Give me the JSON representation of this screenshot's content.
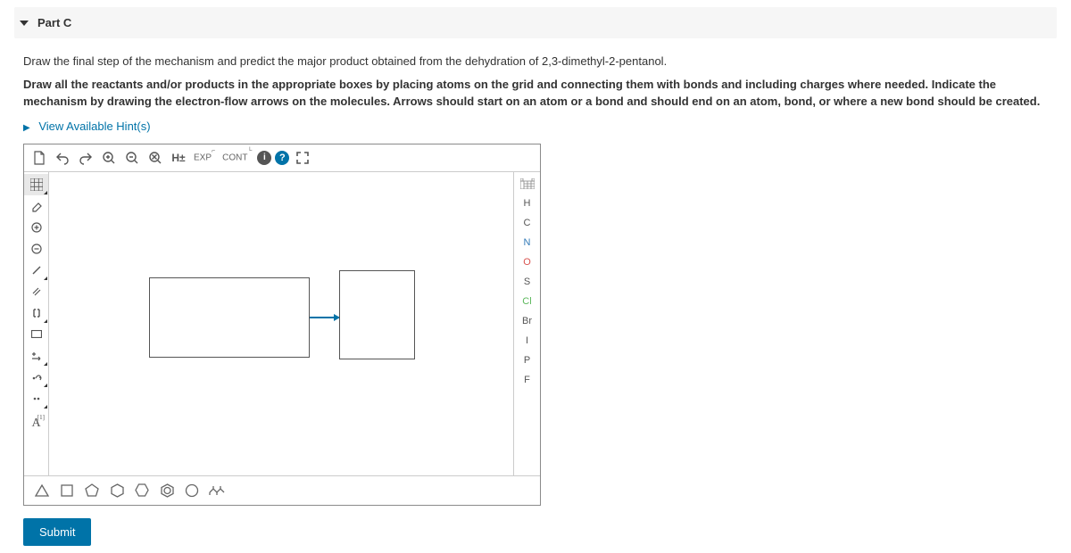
{
  "header": {
    "title": "Part C"
  },
  "instructions": {
    "line1": "Draw the final step of the mechanism and predict the major product obtained from the dehydration of 2,3-dimethyl-2-pentanol.",
    "line2": "Draw all the reactants and/or products in the appropriate boxes by placing atoms on the grid and connecting them with bonds and including charges where needed. Indicate the mechanism by drawing the electron-flow arrows on the molecules. Arrows should start on an atom or a bond and should end on an atom, bond, or where a new bond should be created."
  },
  "hints": {
    "label": "View Available Hint(s)"
  },
  "toolbar": {
    "h_label": "H±",
    "exp": "EXP",
    "cont": "CONT"
  },
  "left_tools": {
    "atom_label": "A"
  },
  "elements": [
    "H",
    "C",
    "N",
    "O",
    "S",
    "Cl",
    "Br",
    "I",
    "P",
    "F"
  ],
  "colors": {
    "o": "#d9534f",
    "n": "#337ab7",
    "cl": "#5cb85c"
  },
  "submit": {
    "label": "Submit"
  }
}
